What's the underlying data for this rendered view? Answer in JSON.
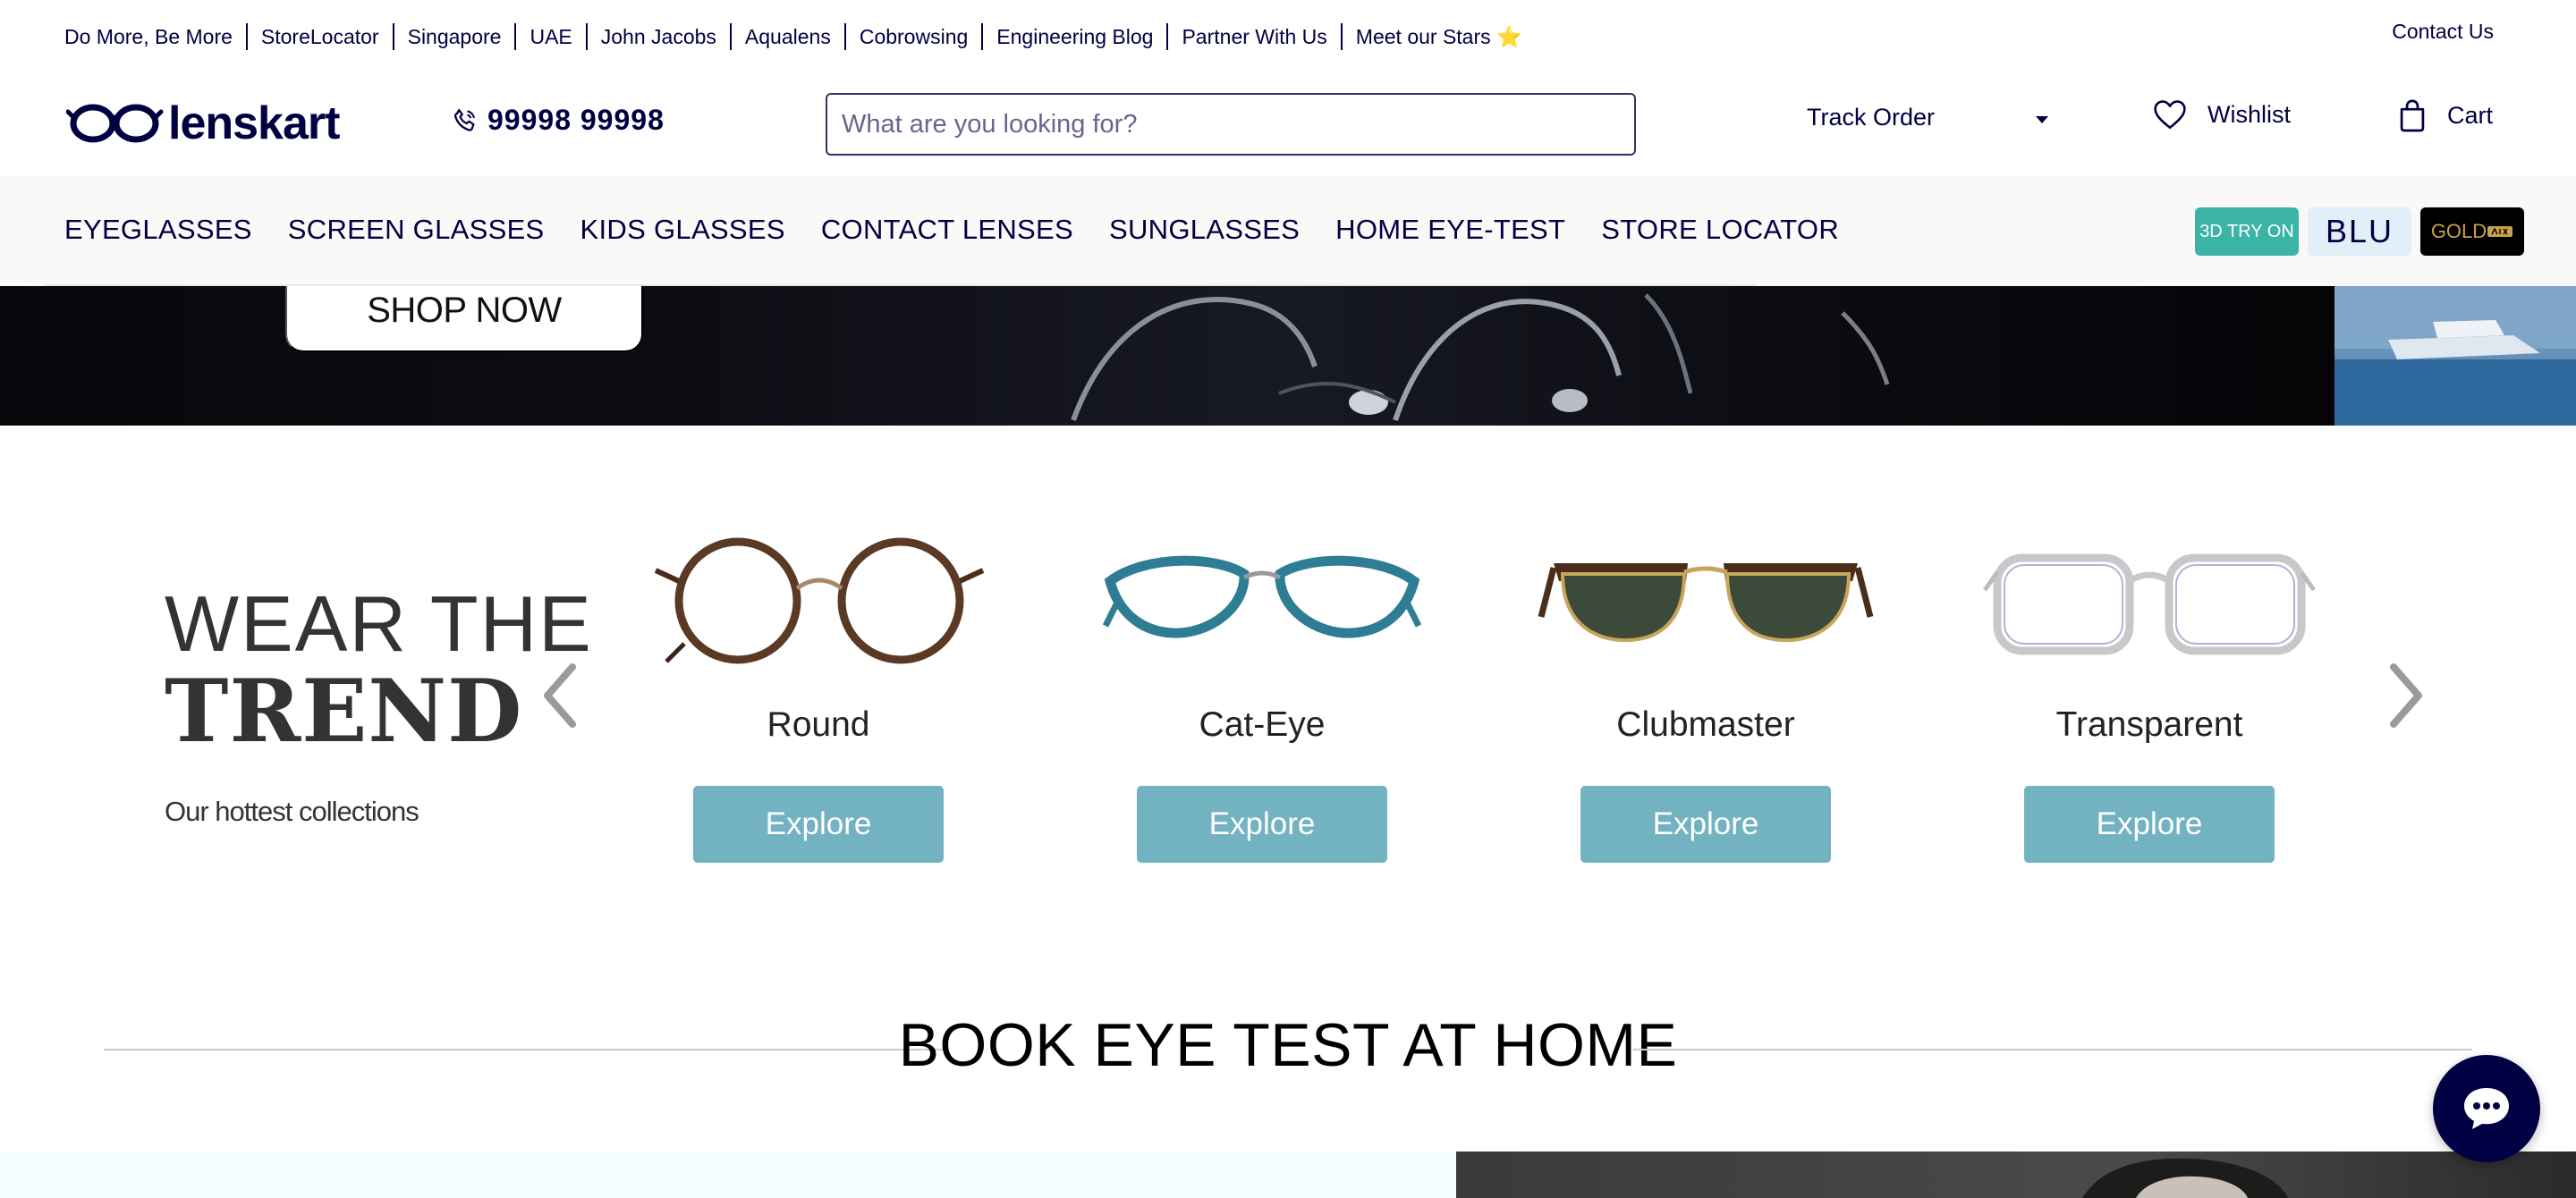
{
  "top_links": [
    "Do More, Be More",
    "StoreLocator",
    "Singapore",
    "UAE",
    "John Jacobs",
    "Aqualens",
    "Cobrowsing",
    "Engineering Blog",
    "Partner With Us",
    "Meet our Stars ⭐"
  ],
  "contact_label": "Contact Us",
  "logo_text": "lenskart",
  "phone": "99998 99998",
  "search_placeholder": "What are you looking for?",
  "track_order_label": "Track Order",
  "wishlist_label": "Wishlist",
  "cart_label": "Cart",
  "nav_items": [
    "EYEGLASSES",
    "SCREEN GLASSES",
    "KIDS GLASSES",
    "CONTACT LENSES",
    "SUNGLASSES",
    "HOME EYE-TEST",
    "STORE LOCATOR"
  ],
  "badges": {
    "try_on": "3D TRY ON",
    "blu": "BLU",
    "gold": "GOLD"
  },
  "hero": {
    "shop_now": "SHOP NOW"
  },
  "trend": {
    "title_line1": "WEAR THE",
    "title_line2": "TREND",
    "subtitle": "Our hottest collections",
    "cards": [
      {
        "name": "Round",
        "button": "Explore"
      },
      {
        "name": "Cat-Eye",
        "button": "Explore"
      },
      {
        "name": "Clubmaster",
        "button": "Explore"
      },
      {
        "name": "Transparent",
        "button": "Explore"
      }
    ]
  },
  "book_eye_test_title": "BOOK EYE TEST AT HOME",
  "colors": {
    "brand_navy": "#000042",
    "explore_button": "#73b2c1",
    "try_on_badge": "#3bb4a5"
  }
}
